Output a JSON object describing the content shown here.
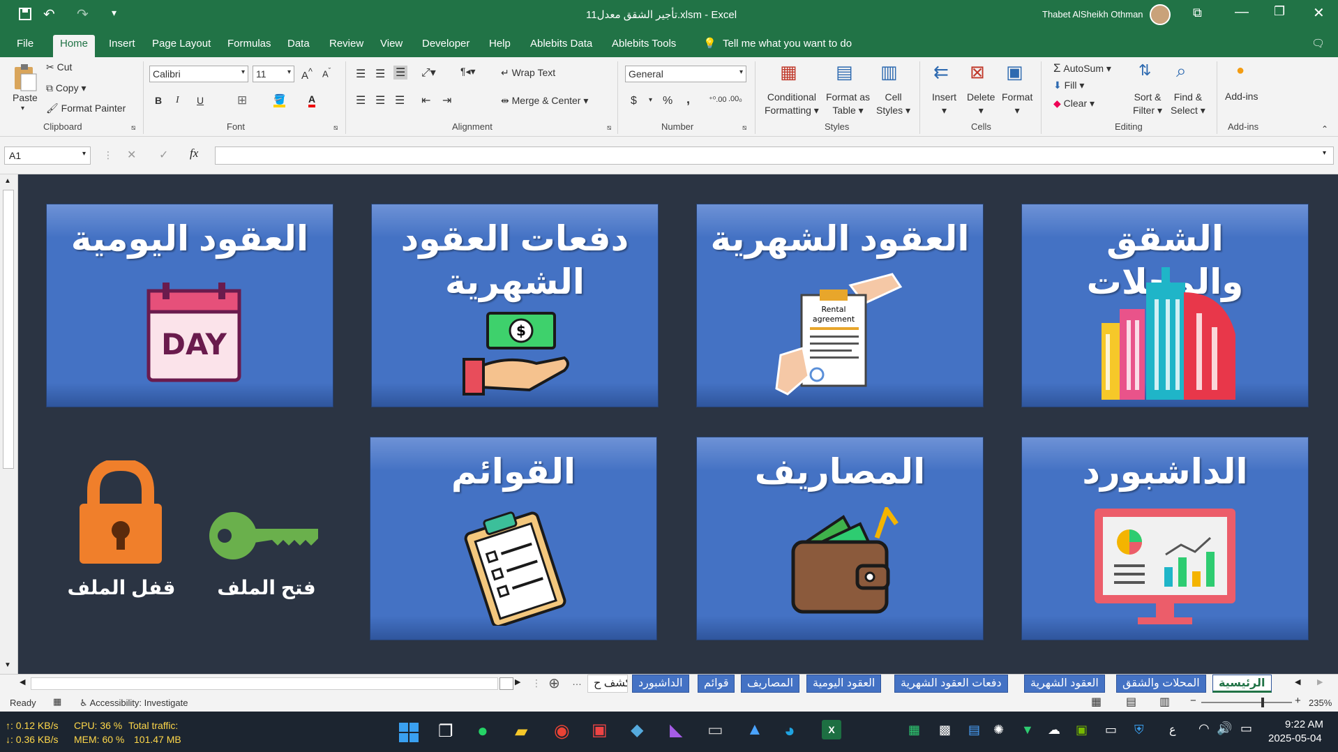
{
  "title_bar": {
    "filename": "تأجير الشقق معدل11.xlsm",
    "app": "Excel",
    "separator": " - ",
    "user": "Thabet AlSheikh Othman"
  },
  "menu": {
    "tabs": [
      "File",
      "Home",
      "Insert",
      "Page Layout",
      "Formulas",
      "Data",
      "Review",
      "View",
      "Developer",
      "Help",
      "Ablebits Data",
      "Ablebits Tools"
    ],
    "active": "Home",
    "tell_me": "Tell me what you want to do"
  },
  "ribbon": {
    "clipboard": {
      "paste": "Paste",
      "cut": "Cut",
      "copy": "Copy",
      "format_painter": "Format Painter",
      "group": "Clipboard"
    },
    "font": {
      "name": "Calibri",
      "size": "11",
      "group": "Font",
      "bold": "B",
      "italic": "I",
      "underline": "U"
    },
    "alignment": {
      "wrap_text": "Wrap Text",
      "merge_center": "Merge & Center",
      "group": "Alignment"
    },
    "number": {
      "format": "General",
      "currency": "$",
      "percent": "%",
      "comma": ",",
      "group": "Number"
    },
    "styles": {
      "conditional": [
        "Conditional",
        "Formatting"
      ],
      "format_table": [
        "Format as",
        "Table"
      ],
      "cell_styles": [
        "Cell",
        "Styles"
      ],
      "group": "Styles"
    },
    "cells": {
      "insert": "Insert",
      "delete": "Delete",
      "format": "Format",
      "group": "Cells"
    },
    "editing": {
      "autosum": "AutoSum",
      "fill": "Fill",
      "clear": "Clear",
      "sort": [
        "Sort &",
        "Filter"
      ],
      "find": [
        "Find &",
        "Select"
      ],
      "group": "Editing"
    },
    "addins": {
      "label": "Add-ins",
      "group": "Add-ins"
    }
  },
  "formula_bar": {
    "name_box": "A1",
    "fx": "fx",
    "cancel": "✕",
    "enter": "✓",
    "value": ""
  },
  "tiles": {
    "daily": "العقود اليومية",
    "payments": [
      "دفعات العقود",
      "الشهرية"
    ],
    "monthly": "العقود الشهرية",
    "apartments": "الشقق والمحلات",
    "lists": "القوائم",
    "expenses": "المصاريف",
    "dashboard": "الداشبورد",
    "day_label": "DAY",
    "rental_label": [
      "Rental",
      "agreement"
    ]
  },
  "lock": {
    "lock_label": "قفل الملف",
    "unlock_label": "فتح الملف"
  },
  "sheet_tabs": [
    "الرئيسية",
    "المحلات والشقق",
    "العقود الشهرية",
    "دفعات العقود الشهرية",
    "العقود اليومية",
    "المصاريف",
    "قوائم",
    "الداشبورد",
    "كشف ح"
  ],
  "sheet_tab_active": "الرئيسية",
  "status": {
    "ready": "Ready",
    "accessibility": "Accessibility: Investigate",
    "zoom": "235%"
  },
  "taskbar": {
    "up": "↑: 0.12 KB/s",
    "down": "↓: 0.36 KB/s",
    "cpu": "CPU: 36 %",
    "mem": "MEM: 60 %",
    "traffic_label": "Total traffic:",
    "traffic_value": "101.47 MB",
    "time": "9:22 AM",
    "date": "2025-05-04",
    "lang": "ع"
  },
  "colors": {
    "excel_green": "#217346",
    "tile_blue": "#4472c4",
    "sheet_bg": "#2b3443",
    "lock_orange": "#f07f2b",
    "key_green": "#6ab04c"
  }
}
